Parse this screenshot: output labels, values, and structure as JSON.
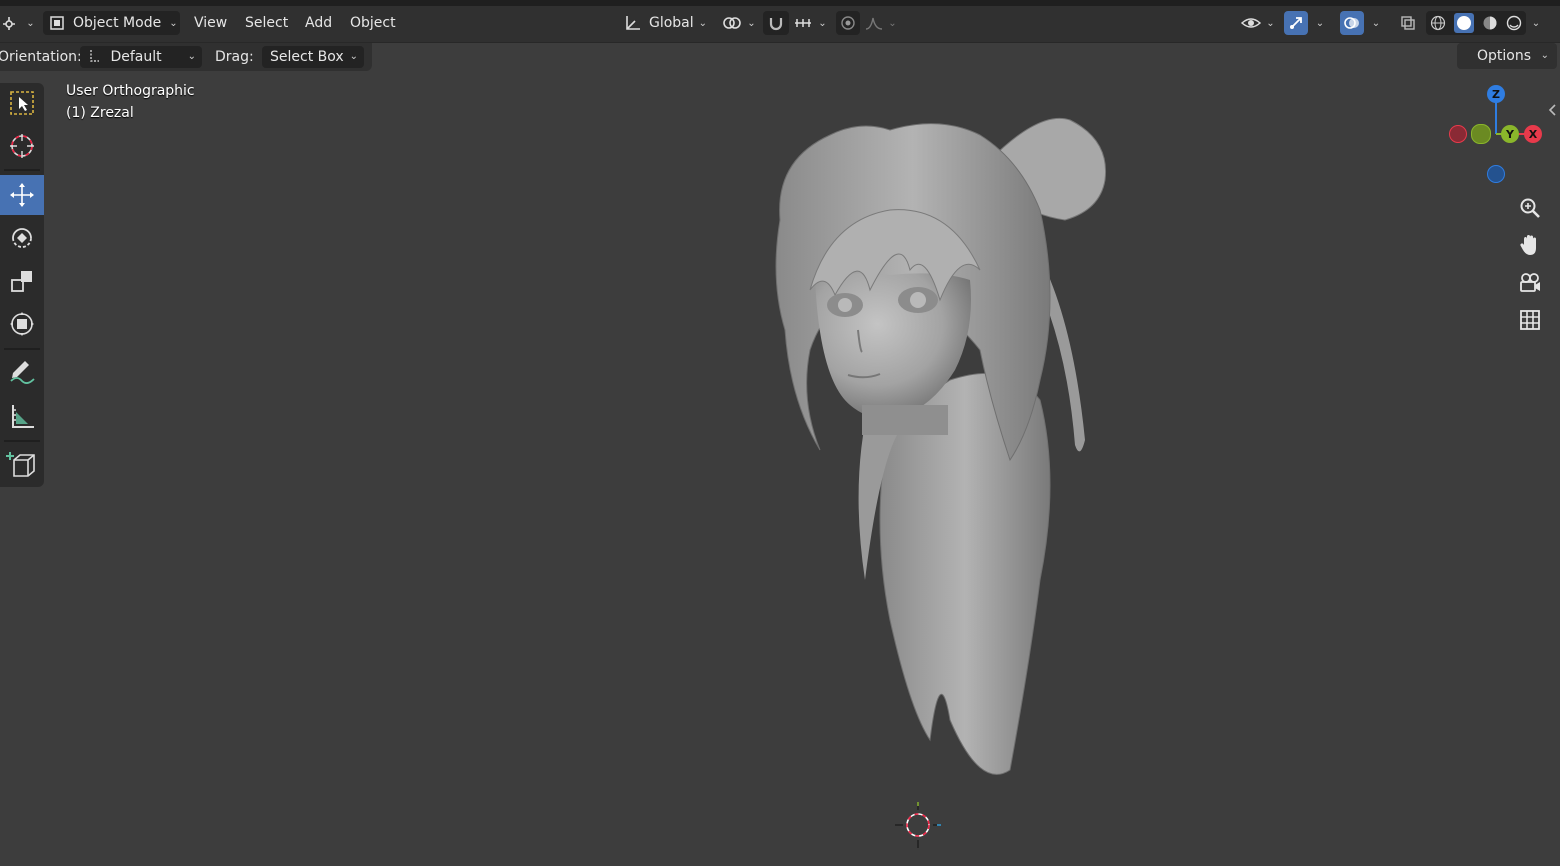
{
  "header": {
    "editor_type_icon": "editor-type-icon",
    "mode": "Object Mode",
    "menus": [
      "View",
      "Select",
      "Add",
      "Object"
    ],
    "transform_orientation": "Global",
    "shading_modes": [
      "wireframe",
      "solid",
      "material-preview",
      "rendered"
    ],
    "active_shading": "solid"
  },
  "tool_header": {
    "orientation_label": "Orientation:",
    "orientation_value": "Default",
    "drag_label": "Drag:",
    "drag_value": "Select Box",
    "options_label": "Options"
  },
  "toolbar": {
    "tools": [
      "select-box",
      "cursor",
      "move",
      "rotate",
      "scale",
      "transform",
      "annotate",
      "measure",
      "add-cube"
    ],
    "active_tool": "move"
  },
  "viewport": {
    "view_name": "User Orthographic",
    "object_info": "(1) Zrezal",
    "object_description": "head-sculpt"
  },
  "gizmo": {
    "axis_z": "Z",
    "axis_y": "Y",
    "axis_x": "X",
    "colors": {
      "x": "#e83a4b",
      "y": "#8ab62b",
      "z": "#2f7de1"
    }
  },
  "nav_buttons": [
    "zoom-icon",
    "pan-hand-icon",
    "camera-icon",
    "grid-icon"
  ],
  "colors": {
    "viewport_bg": "#3d3d3d",
    "header_bg": "#303030",
    "active_tool": "#4772b3"
  }
}
